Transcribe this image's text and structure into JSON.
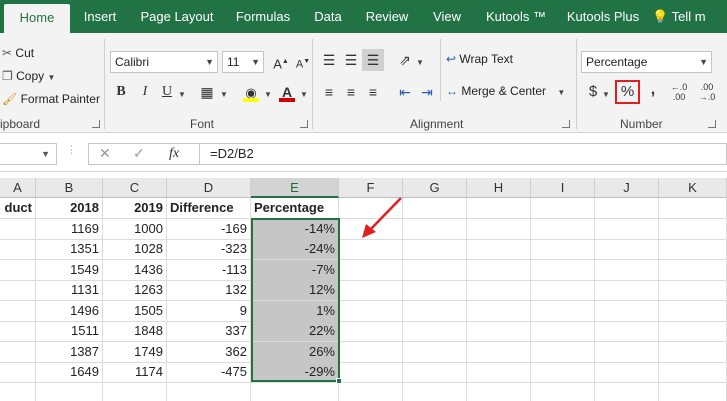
{
  "tabs": [
    {
      "label": "Home",
      "active": true
    },
    {
      "label": "Insert",
      "active": false
    },
    {
      "label": "Page Layout",
      "active": false
    },
    {
      "label": "Formulas",
      "active": false
    },
    {
      "label": "Data",
      "active": false
    },
    {
      "label": "Review",
      "active": false
    },
    {
      "label": "View",
      "active": false
    },
    {
      "label": "Kutools ™",
      "active": false
    },
    {
      "label": "Kutools Plus",
      "active": false
    },
    {
      "label": "Tell m",
      "active": false
    }
  ],
  "clipboard": {
    "cut_label": "Cut",
    "copy_label": "Copy",
    "format_painter_label": "Format Painter",
    "group_label": "ipboard"
  },
  "font": {
    "font_name": "Calibri",
    "font_size": "11",
    "bold": "B",
    "italic": "I",
    "underline": "U",
    "group_label": "Font",
    "font_color": "#d40000",
    "highlight_color": "#ffff00"
  },
  "alignment": {
    "wrap_text_label": "Wrap Text",
    "merge_center_label": "Merge & Center",
    "group_label": "Alignment"
  },
  "number": {
    "format_value": "Percentage",
    "currency_symbol": "$",
    "percent_symbol": "%",
    "comma_symbol": ",",
    "group_label": "Number"
  },
  "formula_bar": {
    "fx_label": "fx",
    "formula": "=D2/B2"
  },
  "grid": {
    "columns": [
      "A",
      "B",
      "C",
      "D",
      "E",
      "F",
      "G",
      "H",
      "I",
      "J",
      "K"
    ],
    "headers": [
      "duct",
      "2018",
      "2019",
      "Difference",
      "Percentage"
    ],
    "rows": [
      {
        "b": "1169",
        "c": "1000",
        "d": "-169",
        "e": "-14%"
      },
      {
        "b": "1351",
        "c": "1028",
        "d": "-323",
        "e": "-24%"
      },
      {
        "b": "1549",
        "c": "1436",
        "d": "-113",
        "e": "-7%"
      },
      {
        "b": "1131",
        "c": "1263",
        "d": "132",
        "e": "12%"
      },
      {
        "b": "1496",
        "c": "1505",
        "d": "9",
        "e": "1%"
      },
      {
        "b": "1511",
        "c": "1848",
        "d": "337",
        "e": "22%"
      },
      {
        "b": "1387",
        "c": "1749",
        "d": "362",
        "e": "26%"
      },
      {
        "b": "1649",
        "c": "1174",
        "d": "-475",
        "e": "-29%"
      }
    ]
  },
  "colors": {
    "accent": "#217346",
    "highlight_box": "#e02020",
    "annotation_arrow": "#e02020"
  }
}
